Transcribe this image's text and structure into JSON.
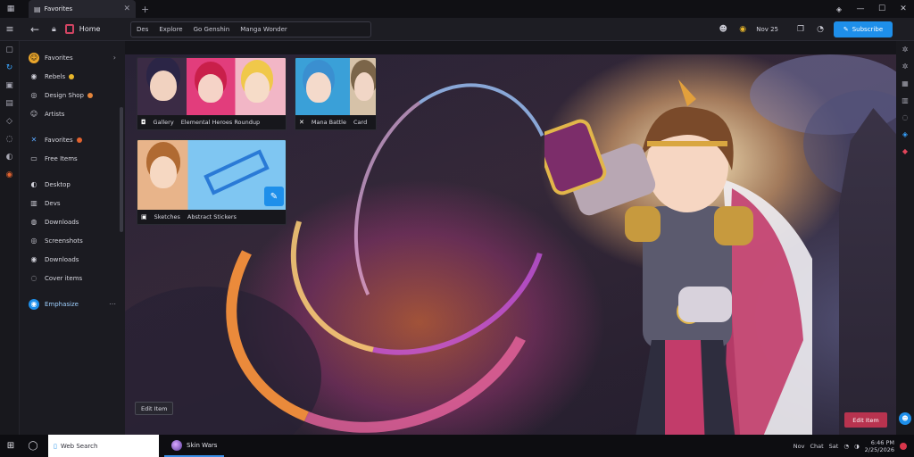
{
  "window": {
    "tab_label": "Favorites",
    "controls": {
      "minimize": "—",
      "maximize": "☐",
      "close": "✕"
    }
  },
  "toolbar": {
    "title": "Home",
    "address_segments": [
      "Des",
      "Explore",
      "Go Genshin",
      "Manga Wonder"
    ],
    "status_text": "Nov 25",
    "primary_button": "Subscribe"
  },
  "sidebar": {
    "items": [
      {
        "label": "Favorites",
        "icon": "☺",
        "style": "highlight",
        "chev": "›"
      },
      {
        "label": "Rebels",
        "icon": "◉",
        "badge": "#e9b72b"
      },
      {
        "label": "Design Shop",
        "icon": "◎",
        "badge": "#e5853b"
      },
      {
        "label": "Artists",
        "icon": "☺"
      },
      {
        "label": "Favorites",
        "icon": "✕",
        "badge": "#e2632f",
        "gap": true
      },
      {
        "label": "Free Items",
        "icon": "▭"
      },
      {
        "label": "Desktop",
        "icon": "◐",
        "gap": true
      },
      {
        "label": "Devs",
        "icon": "▥"
      },
      {
        "label": "Downloads",
        "icon": "◍"
      },
      {
        "label": "Screenshots",
        "icon": "◎"
      },
      {
        "label": "Downloads",
        "icon": "◉"
      },
      {
        "label": "Cover items",
        "icon": "◌"
      },
      {
        "label": "Emphasize",
        "icon": "◉",
        "style": "blue",
        "chev": "⋯",
        "gap": true
      }
    ]
  },
  "thumbs": [
    {
      "caption_a": "Gallery",
      "caption_b": "Elemental Heroes Roundup",
      "icon_a": "◘"
    },
    {
      "caption_a": "Mana Battle",
      "caption_b": "Card",
      "icon_a": "✕"
    },
    {
      "caption_a": "Sketches",
      "caption_b": "Abstract Stickers",
      "icon_a": "▣"
    }
  ],
  "overlay": {
    "left_button": "Edit Item",
    "right_button": "Edit Item"
  },
  "taskbar": {
    "search_placeholder": "Web Search",
    "app_label": "Skin Wars",
    "tray_a": "Nov",
    "tray_b": "Chat",
    "tray_c": "Sat",
    "time": "6:46 PM",
    "date": "2/25/2026"
  },
  "colors": {
    "accent": "#1e8fea",
    "brand": "#d04462",
    "danger": "#b8334f"
  }
}
